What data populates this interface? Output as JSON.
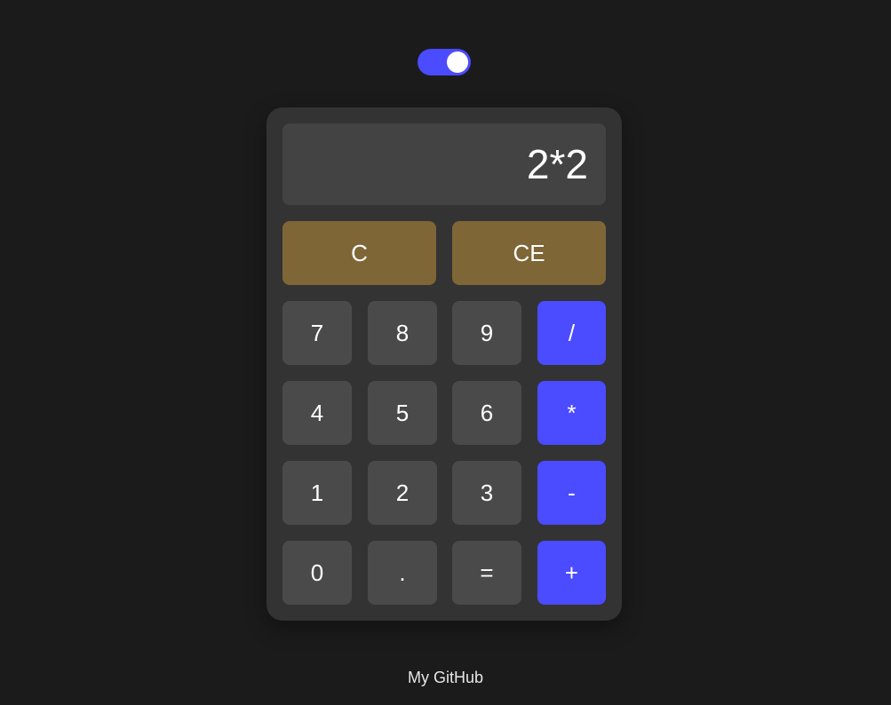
{
  "display": {
    "value": "2*2"
  },
  "buttons": {
    "clear": "C",
    "clear_entry": "CE",
    "seven": "7",
    "eight": "8",
    "nine": "9",
    "divide": "/",
    "four": "4",
    "five": "5",
    "six": "6",
    "multiply": "*",
    "one": "1",
    "two": "2",
    "three": "3",
    "subtract": "-",
    "zero": "0",
    "decimal": ".",
    "equals": "=",
    "add": "+"
  },
  "footer": {
    "link_label": "My GitHub"
  },
  "theme_toggle": {
    "state": "on",
    "accent_color": "#4b4bff"
  },
  "colors": {
    "background": "#1b1b1b",
    "calculator_body": "#333333",
    "display": "#434343",
    "number_button": "#4a4a4a",
    "clear_button": "#7e6636",
    "operator_button": "#4b4bff"
  }
}
